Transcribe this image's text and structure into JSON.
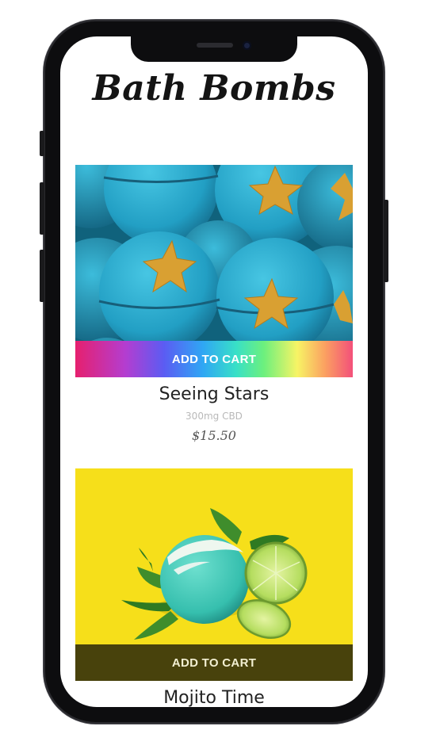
{
  "header": {
    "title": "Bath Bombs"
  },
  "products": [
    {
      "add_to_cart": "ADD TO CART",
      "name": "Seeing Stars",
      "description": "300mg CBD",
      "price": "$15.50",
      "image_icon": "blue-star-bath-bombs-image"
    },
    {
      "add_to_cart": "ADD TO CART",
      "name": "Mojito Time",
      "image_icon": "mint-lime-bath-bomb-image"
    }
  ],
  "colors": {
    "bomb_blue": "#2bb3d4",
    "star_gold": "#d9a032",
    "mojito_yellow": "#f6df1a",
    "mojito_bomb": "#48c9b6",
    "lime": "#a9d851",
    "mint": "#3f8d2c"
  }
}
